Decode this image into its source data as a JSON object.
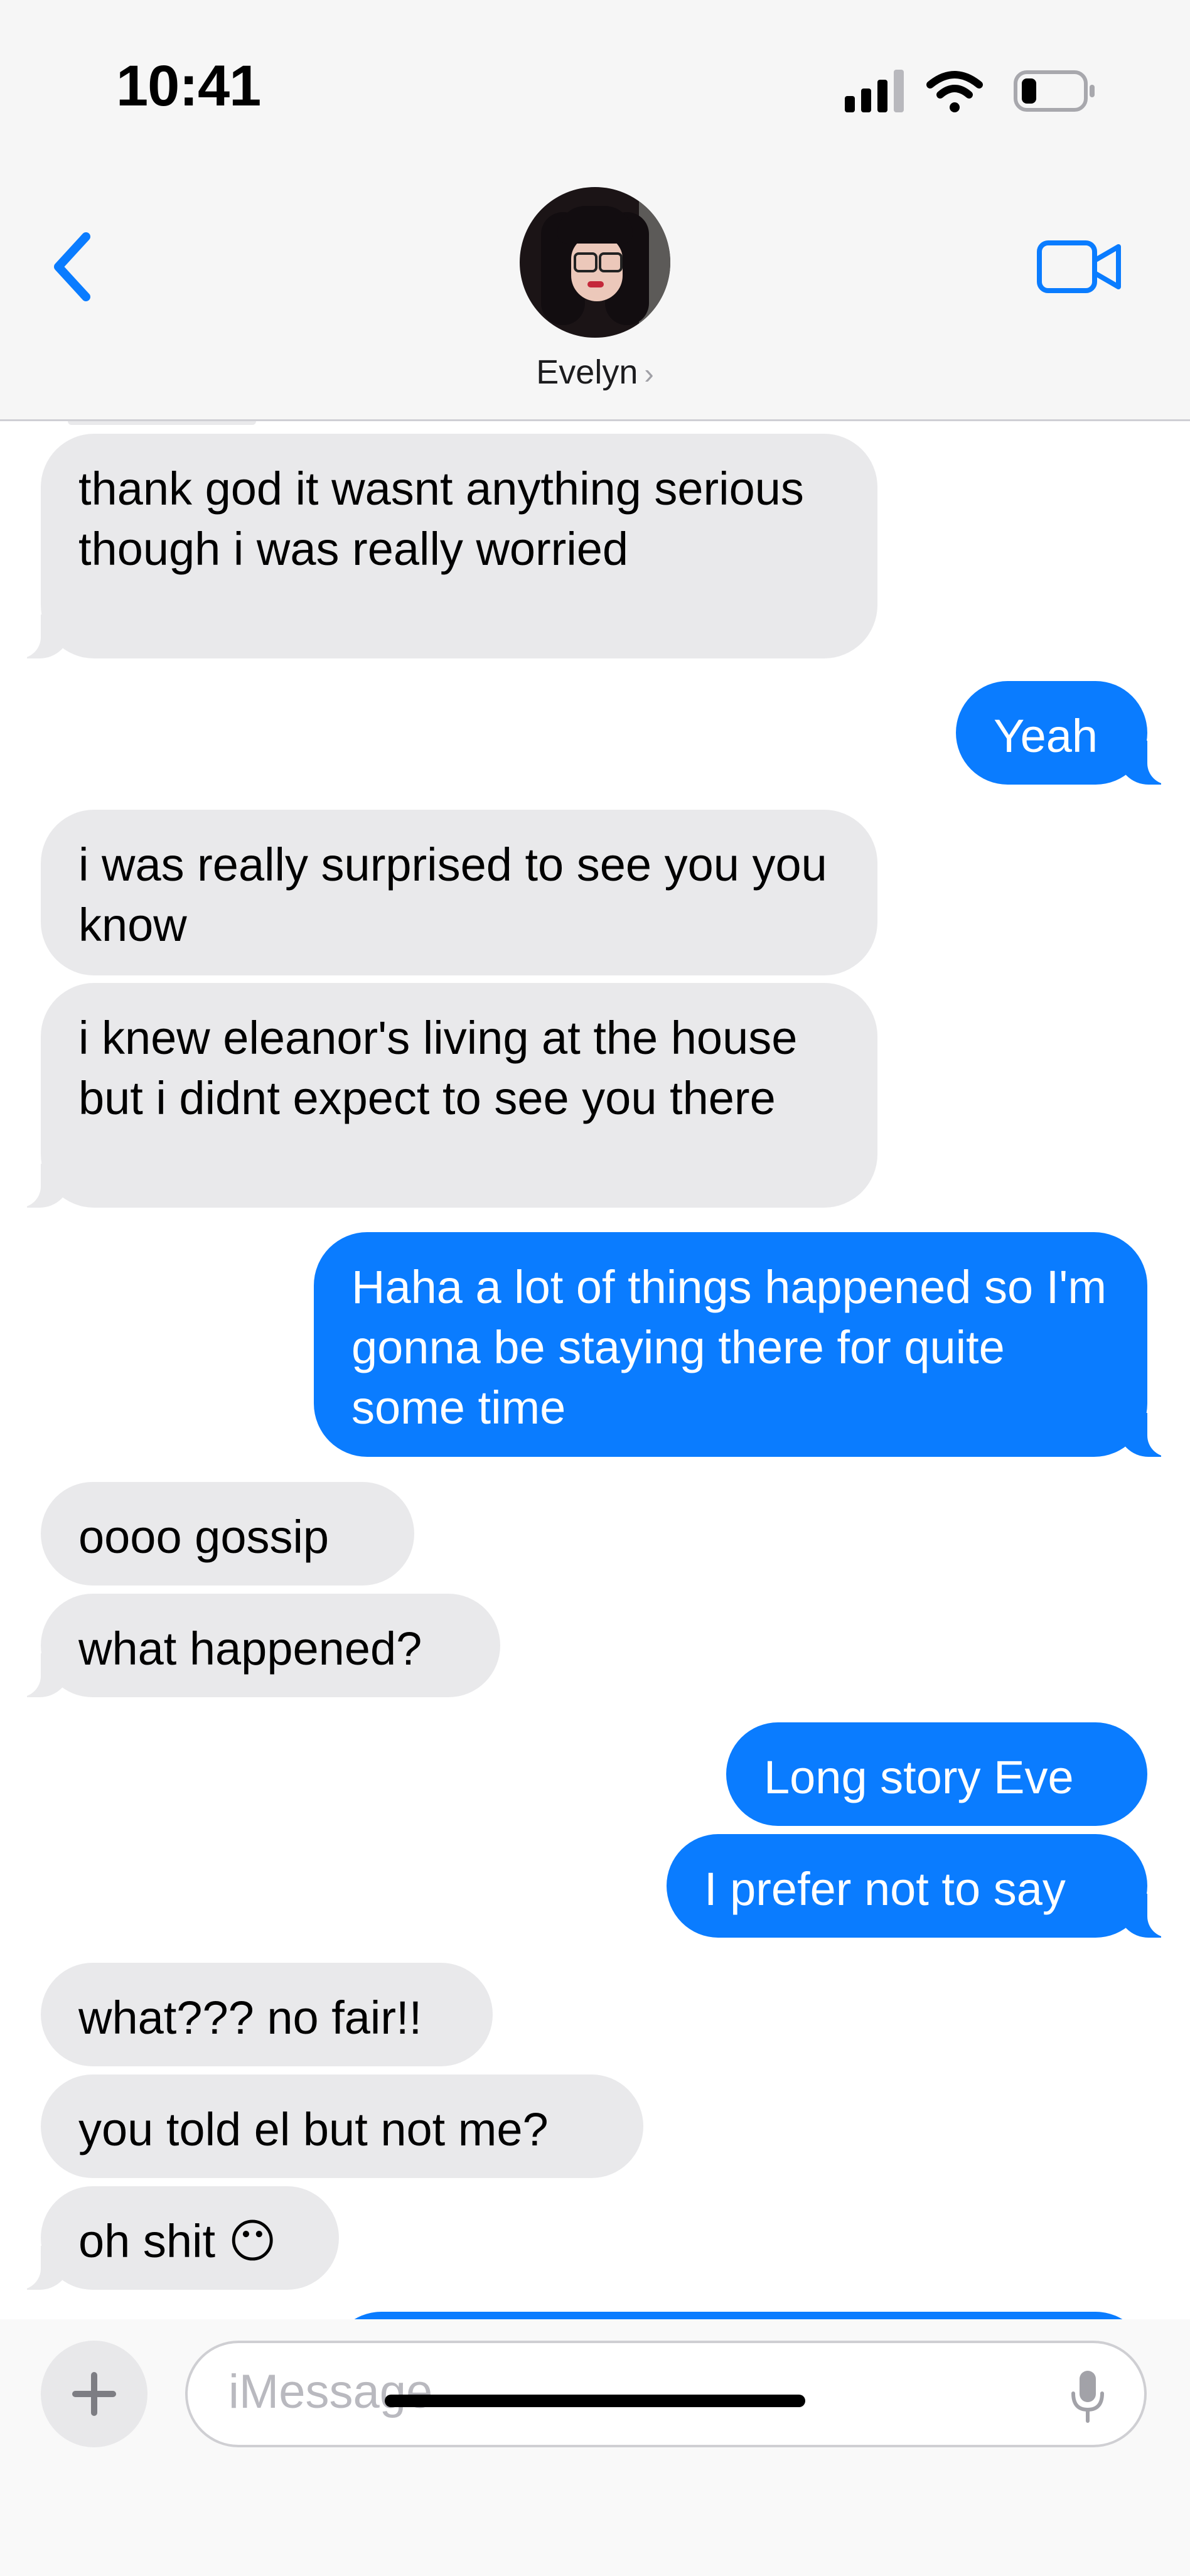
{
  "status_bar": {
    "time": "10:41",
    "battery_level": 0.25
  },
  "header": {
    "contact_name": "Evelyn",
    "name_chevron": "›",
    "back_icon": "chevron-left-icon",
    "video_icon": "video-camera-icon"
  },
  "colors": {
    "accent": "#0a7cff",
    "received_bubble": "#e9e9eb",
    "header_bg": "#f6f6f6"
  },
  "messages": [
    {
      "from": "them",
      "text": "thank god it wasnt anything serious though i was really worried"
    },
    {
      "from": "me",
      "text": "Yeah"
    },
    {
      "from": "them",
      "text": "i was really surprised to see you you know"
    },
    {
      "from": "them",
      "text": "i knew eleanor's living at the house but i didnt expect to see you there"
    },
    {
      "from": "me",
      "text": "Haha a lot of things happened so I'm gonna be staying there for quite some time"
    },
    {
      "from": "them",
      "text": "oooo gossip"
    },
    {
      "from": "them",
      "text": "what happened?"
    },
    {
      "from": "me",
      "text": "Long story Eve"
    },
    {
      "from": "me",
      "text": "I prefer not to say"
    },
    {
      "from": "them",
      "text": "what??? no fair!!"
    },
    {
      "from": "them",
      "text": "you told el but not me?"
    },
    {
      "from": "them",
      "text": "oh shit 😶"
    }
  ],
  "composer": {
    "placeholder": "iMessage",
    "plus_label": "+",
    "mic_icon": "microphone-icon"
  }
}
